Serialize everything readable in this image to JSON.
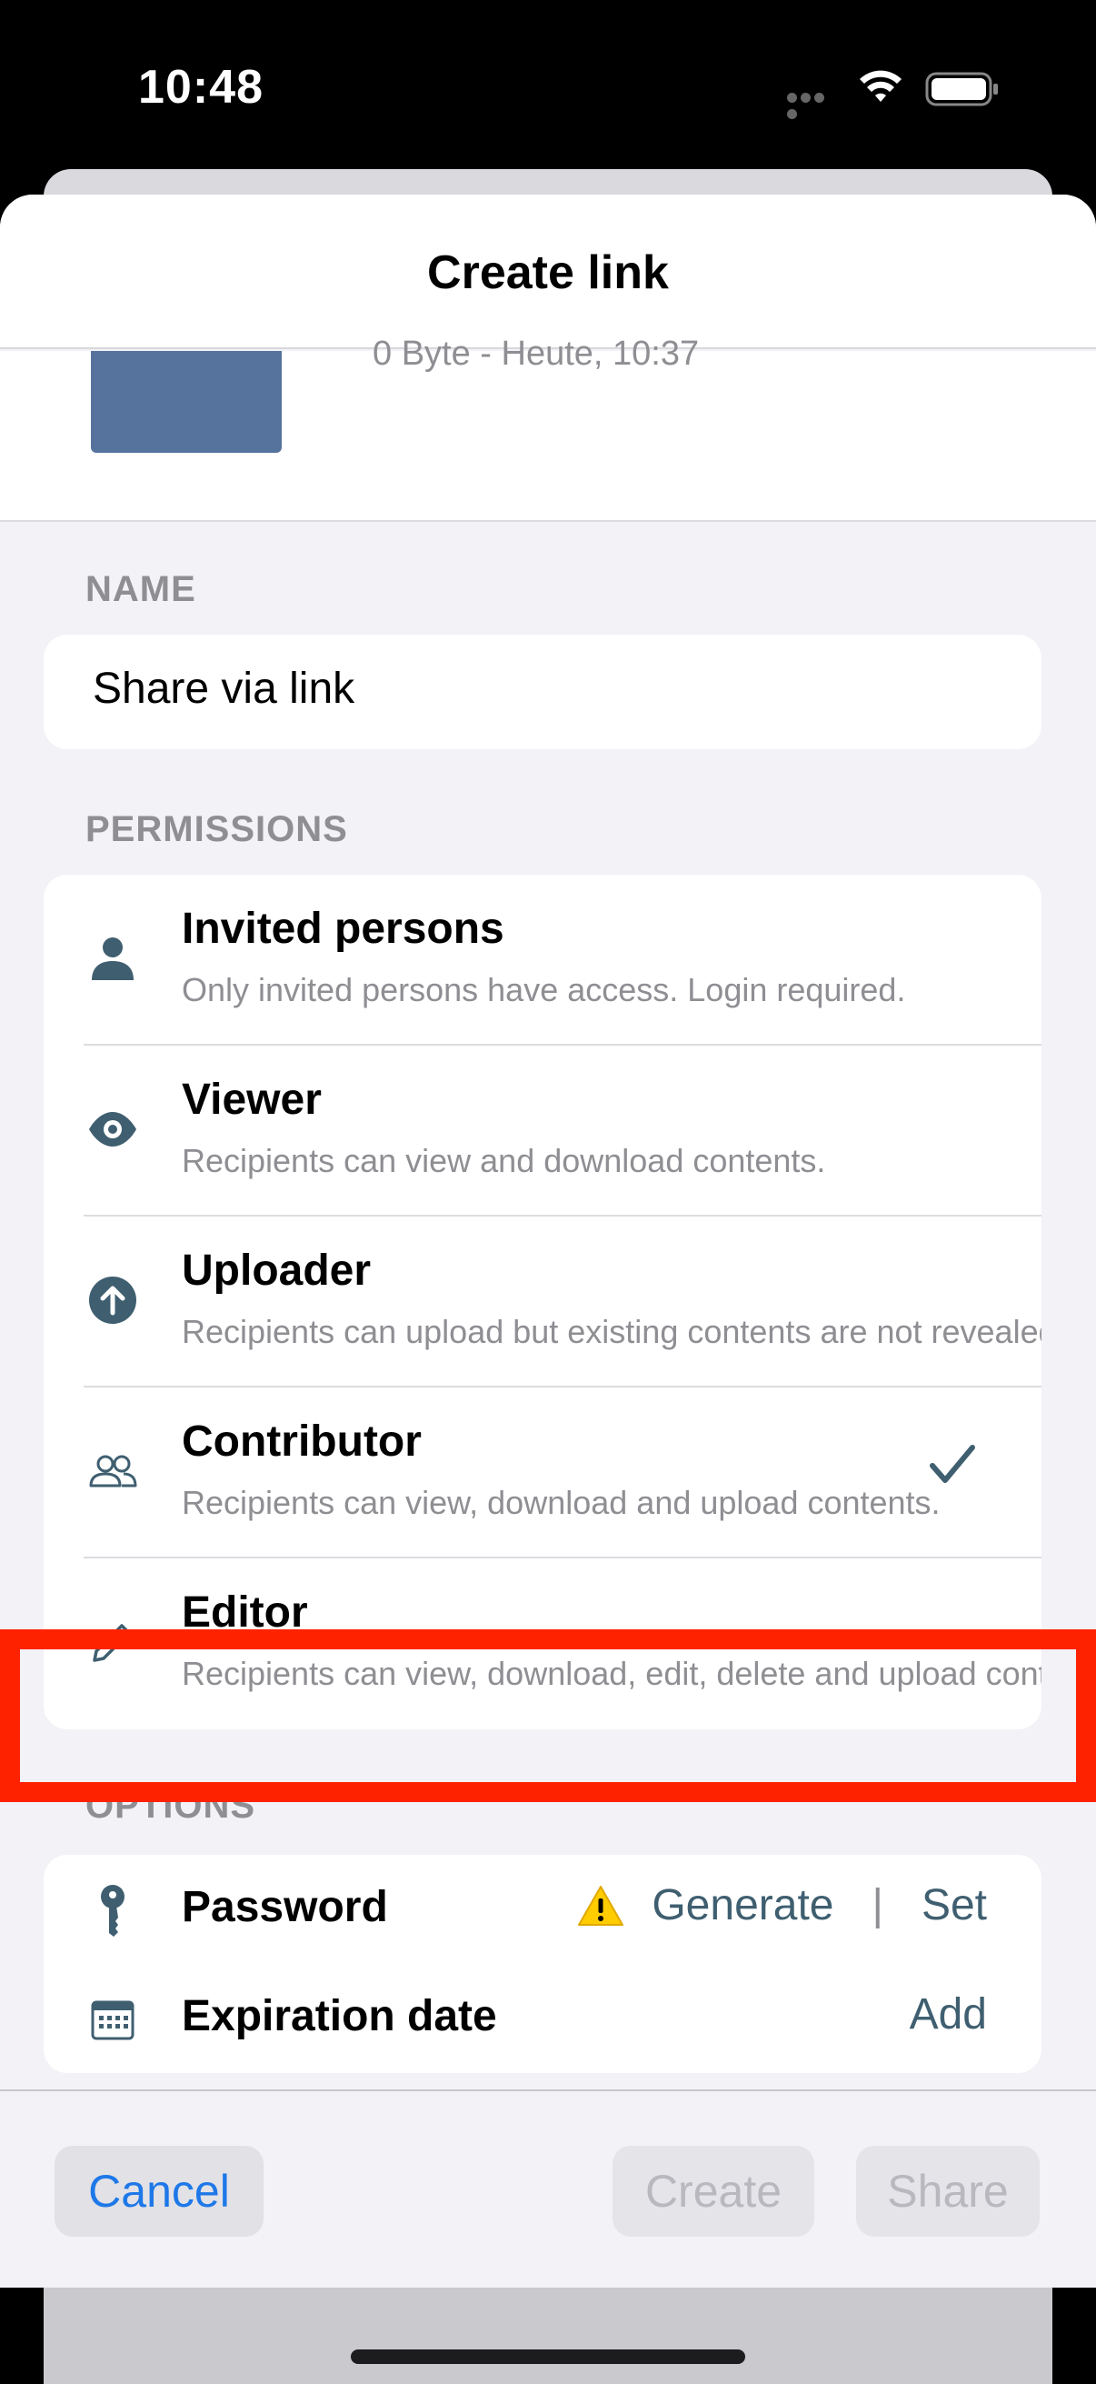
{
  "status_bar": {
    "time": "10:48"
  },
  "sheet": {
    "title": "Create link"
  },
  "file": {
    "meta": "0 Byte - Heute, 10:37"
  },
  "name_section": {
    "label": "NAME",
    "value": "Share via link"
  },
  "permissions_section": {
    "label": "PERMISSIONS",
    "items": [
      {
        "title": "Invited persons",
        "desc": "Only invited persons have access. Login required.",
        "icon": "person-icon",
        "selected": false
      },
      {
        "title": "Viewer",
        "desc": "Recipients can view and download contents.",
        "icon": "eye-icon",
        "selected": false
      },
      {
        "title": "Uploader",
        "desc": "Recipients can upload but existing contents are not revealed.",
        "icon": "upload-arrow-icon",
        "selected": false
      },
      {
        "title": "Contributor",
        "desc": "Recipients can view, download and upload contents.",
        "icon": "people-icon",
        "selected": true
      },
      {
        "title": "Editor",
        "desc": "Recipients can view, download, edit, delete and upload contents.",
        "icon": "pencil-icon",
        "selected": false
      }
    ]
  },
  "options_section": {
    "label": "OPTIONS",
    "password": {
      "title": "Password",
      "generate": "Generate",
      "separator": "|",
      "set": "Set"
    },
    "expiration": {
      "title": "Expiration date",
      "add": "Add"
    }
  },
  "footer": {
    "cancel": "Cancel",
    "create": "Create",
    "share": "Share"
  },
  "colors": {
    "accent": "#3f5f70",
    "link_blue": "#1e78e8",
    "highlight": "#ff2200",
    "warning": "#ffcc00"
  }
}
